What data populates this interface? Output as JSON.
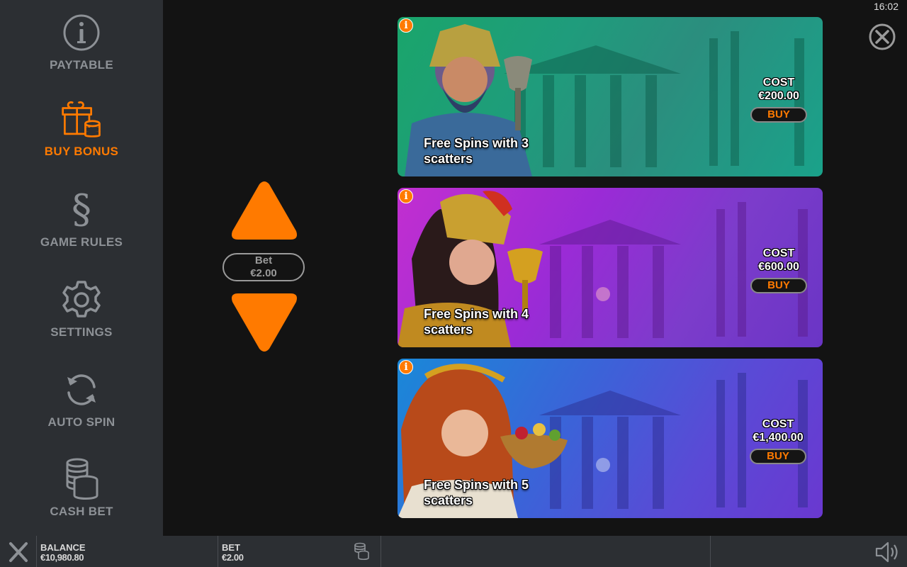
{
  "clock": "16:02",
  "sidebar": {
    "items": [
      {
        "label": "PAYTABLE",
        "icon": "info-circle-icon"
      },
      {
        "label": "BUY BONUS",
        "icon": "gift-coins-icon",
        "active": true
      },
      {
        "label": "GAME RULES",
        "icon": "section-sign-icon"
      },
      {
        "label": "SETTINGS",
        "icon": "gear-icon"
      },
      {
        "label": "AUTO SPIN",
        "icon": "refresh-icon"
      },
      {
        "label": "CASH BET",
        "icon": "coin-stack-icon"
      }
    ]
  },
  "bet_selector": {
    "label": "Bet",
    "value": "€2.00"
  },
  "bonuses": [
    {
      "title": "Free Spins with 3 scatters",
      "cost_label": "COST",
      "cost": "€200.00",
      "buy_label": "BUY",
      "info": "i"
    },
    {
      "title": "Free Spins with 4 scatters",
      "cost_label": "COST",
      "cost": "€600.00",
      "buy_label": "BUY",
      "info": "i"
    },
    {
      "title": "Free Spins with 5 scatters",
      "cost_label": "COST",
      "cost": "€1,400.00",
      "buy_label": "BUY",
      "info": "i"
    }
  ],
  "bottom_bar": {
    "balance_label": "BALANCE",
    "balance_value": "€10,980.80",
    "bet_label": "BET",
    "bet_value": "€2.00"
  },
  "colors": {
    "accent": "#ff7a00",
    "sidebar_bg": "#2c2f33",
    "muted_text": "#8d9196"
  }
}
